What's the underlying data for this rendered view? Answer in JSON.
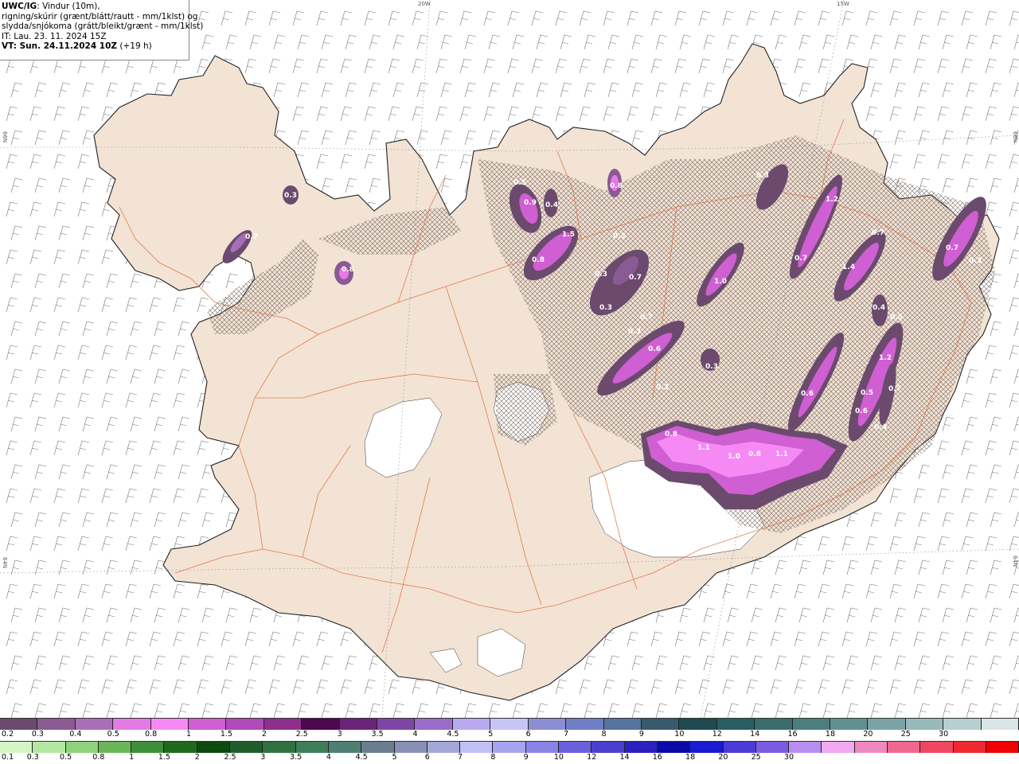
{
  "header": {
    "model": "UWC/IG",
    "line1_rest": ": Vindur (10m),",
    "line2": "rigning/skúrir (grænt/blátt/rautt - mm/1klst) og",
    "line3": "slydda/snjókoma (grátt/bleikt/grænt - mm/1klst)",
    "line4": "IT: Lau. 23. 11. 2024 15Z",
    "line5_label": "VT: Sun. 24.11.2024 10Z",
    "line5_rest": " (+19 h)"
  },
  "graticule_labels": {
    "lon_20w": "20W",
    "lon_15w": "15W",
    "lat_66n_left": "66N",
    "lat_66n_right": "66N",
    "lat_64n_left": "64N",
    "lat_64n_right": "64N"
  },
  "snow_legend": {
    "colors": [
      "#6b4a6e",
      "#8a5a92",
      "#a96fb6",
      "#e47ae6",
      "#f58af5",
      "#cf5fd2",
      "#b04ab8",
      "#8e2f8e",
      "#4c0a4c",
      "#6a2477",
      "#7e46a4",
      "#9a6bc7",
      "#b8a9f0",
      "#c8c4f6",
      "#8b8ed2",
      "#6f7ec4",
      "#56739f",
      "#39596d",
      "#1f4a4f",
      "#2a5e60",
      "#3b6c6c",
      "#4d7e7e",
      "#628f8f",
      "#7ba3a3",
      "#98b9b9",
      "#b7cfcf",
      "#d9e5e5"
    ],
    "ticks": [
      "0.2",
      "0.3",
      "0.4",
      "0.5",
      "0.8",
      "1",
      "1.5",
      "2",
      "2.5",
      "3",
      "3.5",
      "4",
      "4.5",
      "5",
      "6",
      "7",
      "8",
      "9",
      "10",
      "12",
      "14",
      "16",
      "18",
      "20",
      "25",
      "30"
    ]
  },
  "rain_legend": {
    "colors": [
      "#d6f5c6",
      "#b3e8a3",
      "#8fd27c",
      "#6ab55a",
      "#3f8f3a",
      "#1d6a1d",
      "#0d4a0d",
      "#1f5e2a",
      "#2f7240",
      "#3e7d5a",
      "#4f7e73",
      "#6b7e8f",
      "#8890b5",
      "#a3a7d8",
      "#c1c0f5",
      "#a8a4f0",
      "#8a83e6",
      "#6a5fdc",
      "#4a3fce",
      "#2a1fc0",
      "#0a0aa8",
      "#1a1ad0",
      "#4b3cd6",
      "#7a5ce0",
      "#b78ef0",
      "#f0a8f0",
      "#f088c0",
      "#f06890",
      "#f04860",
      "#f02830",
      "#f00000"
    ],
    "ticks": [
      "0.1",
      "0.3",
      "0.5",
      "0.8",
      "1",
      "1.5",
      "2",
      "2.5",
      "3",
      "3.5",
      "4",
      "4.5",
      "5",
      "6",
      "7",
      "8",
      "9",
      "10",
      "12",
      "14",
      "16",
      "18",
      "20",
      "25",
      "30"
    ]
  },
  "precip_labels": [
    {
      "id": "a",
      "text": "0.3"
    },
    {
      "id": "b",
      "text": "0.7"
    },
    {
      "id": "c",
      "text": "0.8"
    },
    {
      "id": "d",
      "text": "0.9"
    },
    {
      "id": "e",
      "text": "0.4"
    },
    {
      "id": "f",
      "text": "0.8"
    },
    {
      "id": "g",
      "text": "1.5"
    },
    {
      "id": "h",
      "text": "0.8"
    },
    {
      "id": "i",
      "text": "0.3"
    },
    {
      "id": "j",
      "text": "0.5"
    },
    {
      "id": "k",
      "text": "0.3"
    },
    {
      "id": "l",
      "text": "0.7"
    },
    {
      "id": "m",
      "text": "0.3"
    },
    {
      "id": "n",
      "text": "0.3"
    },
    {
      "id": "o",
      "text": "0.6"
    },
    {
      "id": "p",
      "text": "0.3"
    },
    {
      "id": "q",
      "text": "1.0"
    },
    {
      "id": "r",
      "text": "0.3"
    },
    {
      "id": "s",
      "text": "1.2"
    },
    {
      "id": "t",
      "text": "0.7"
    },
    {
      "id": "u",
      "text": "0.7"
    },
    {
      "id": "v",
      "text": "1.4"
    },
    {
      "id": "w",
      "text": "0.4"
    },
    {
      "id": "x",
      "text": "0.5"
    },
    {
      "id": "y",
      "text": "0.7"
    },
    {
      "id": "z",
      "text": "0.3"
    },
    {
      "id": "aa",
      "text": "1.2"
    },
    {
      "id": "ab",
      "text": "0.6"
    },
    {
      "id": "ac",
      "text": "0.5"
    },
    {
      "id": "ad",
      "text": "0.6"
    },
    {
      "id": "ae",
      "text": "0.7"
    },
    {
      "id": "af",
      "text": "0.4"
    },
    {
      "id": "ag",
      "text": "0.8"
    },
    {
      "id": "ah",
      "text": "1.1"
    },
    {
      "id": "ai",
      "text": "1.0"
    },
    {
      "id": "aj",
      "text": "0.8"
    },
    {
      "id": "ak",
      "text": "1.1"
    },
    {
      "id": "al",
      "text": "0.7"
    },
    {
      "id": "am",
      "text": "0.3"
    }
  ]
}
